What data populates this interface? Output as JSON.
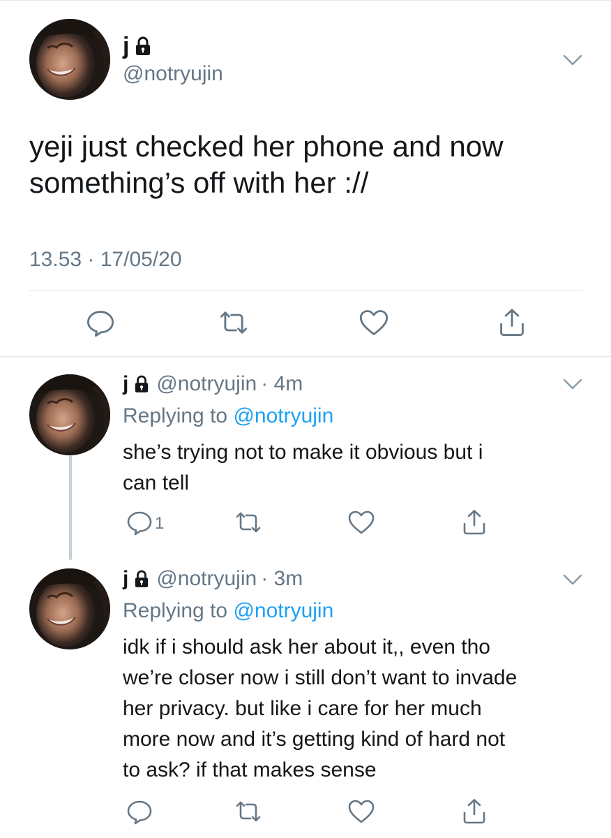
{
  "main_tweet": {
    "name": "j",
    "handle": "@notryujin",
    "text_line1": "yeji just checked her phone and now",
    "text_line2": "something’s off with her ://",
    "meta": "13.53 · 17/05/20"
  },
  "replies": [
    {
      "name": "j",
      "handle": "@notryujin",
      "time": "· 4m",
      "replying_prefix": "Replying to ",
      "replying_to": "@notryujin",
      "lines": [
        "she’s trying not to make it obvious but i",
        "can tell"
      ],
      "reply_count": "1"
    },
    {
      "name": "j",
      "handle": "@notryujin",
      "time": "· 3m",
      "replying_prefix": "Replying to ",
      "replying_to": "@notryujin",
      "lines": [
        "idk if i should ask her about it,, even tho",
        "we’re closer now i still don’t want to invade",
        "her privacy. but like i care for her much",
        "more now and it’s getting kind of hard not",
        "to ask? if that makes sense"
      ],
      "reply_count": ""
    }
  ],
  "icons": {
    "lock": "lock-icon",
    "chevron": "chevron-down-icon",
    "reply": "reply-icon",
    "retweet": "retweet-icon",
    "like": "heart-icon",
    "share": "share-icon"
  },
  "colors": {
    "text": "#14171a",
    "secondary": "#657786",
    "link": "#1da1f2",
    "divider": "#e1e8ed",
    "thread_line": "#c4cfd6"
  }
}
